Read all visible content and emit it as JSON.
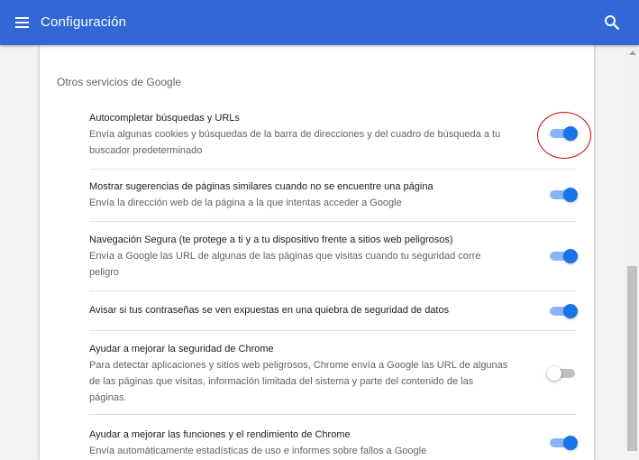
{
  "header": {
    "title": "Configuración",
    "menu_icon": "hamburger-menu-icon",
    "search_icon": "search-icon",
    "bg_color": "#3367d6"
  },
  "section": {
    "title": "Otros servicios de Google",
    "items": [
      {
        "title": "Autocompletar búsquedas y URLs",
        "desc_lines": [
          "Envía algunas cookies y búsquedas de la barra de direcciones y del cuadro de búsqueda a tu",
          "buscador predeterminado"
        ],
        "enabled": true
      },
      {
        "title": "Mostrar sugerencias de páginas similares cuando no se encuentre una página",
        "desc_lines": [
          "Envía la dirección web de la página a la que intentas acceder a Google"
        ],
        "enabled": true
      },
      {
        "title": "Navegación Segura (te protege a ti y a tu dispositivo frente a sitios web peligrosos)",
        "desc_lines": [
          "Envía a Google las URL de algunas de las páginas que visitas cuando tu seguridad corre",
          "peligro"
        ],
        "enabled": true
      },
      {
        "title": "Avisar si tus contraseñas se ven expuestas en una quiebra de seguridad de datos",
        "desc_lines": [],
        "enabled": true
      },
      {
        "title": "Ayudar a mejorar la seguridad de Chrome",
        "desc_lines": [
          "Para detectar aplicaciones y sitios web peligrosos, Chrome envía a Google las URL de algunas",
          "de las páginas que visitas, información limitada del sistema y parte del contenido de las",
          "páginas."
        ],
        "enabled": false
      },
      {
        "title": "Ayudar a mejorar las funciones y el rendimiento de Chrome",
        "desc_lines": [
          "Envía automáticamente estadísticas de uso e informes sobre fallos a Google"
        ],
        "enabled": true
      }
    ]
  },
  "colors": {
    "toggle_on": "#1a73e8",
    "toggle_on_track": "#8ab4f8",
    "toggle_off_track": "#bdc1c6",
    "annotation": "#cc0000"
  }
}
